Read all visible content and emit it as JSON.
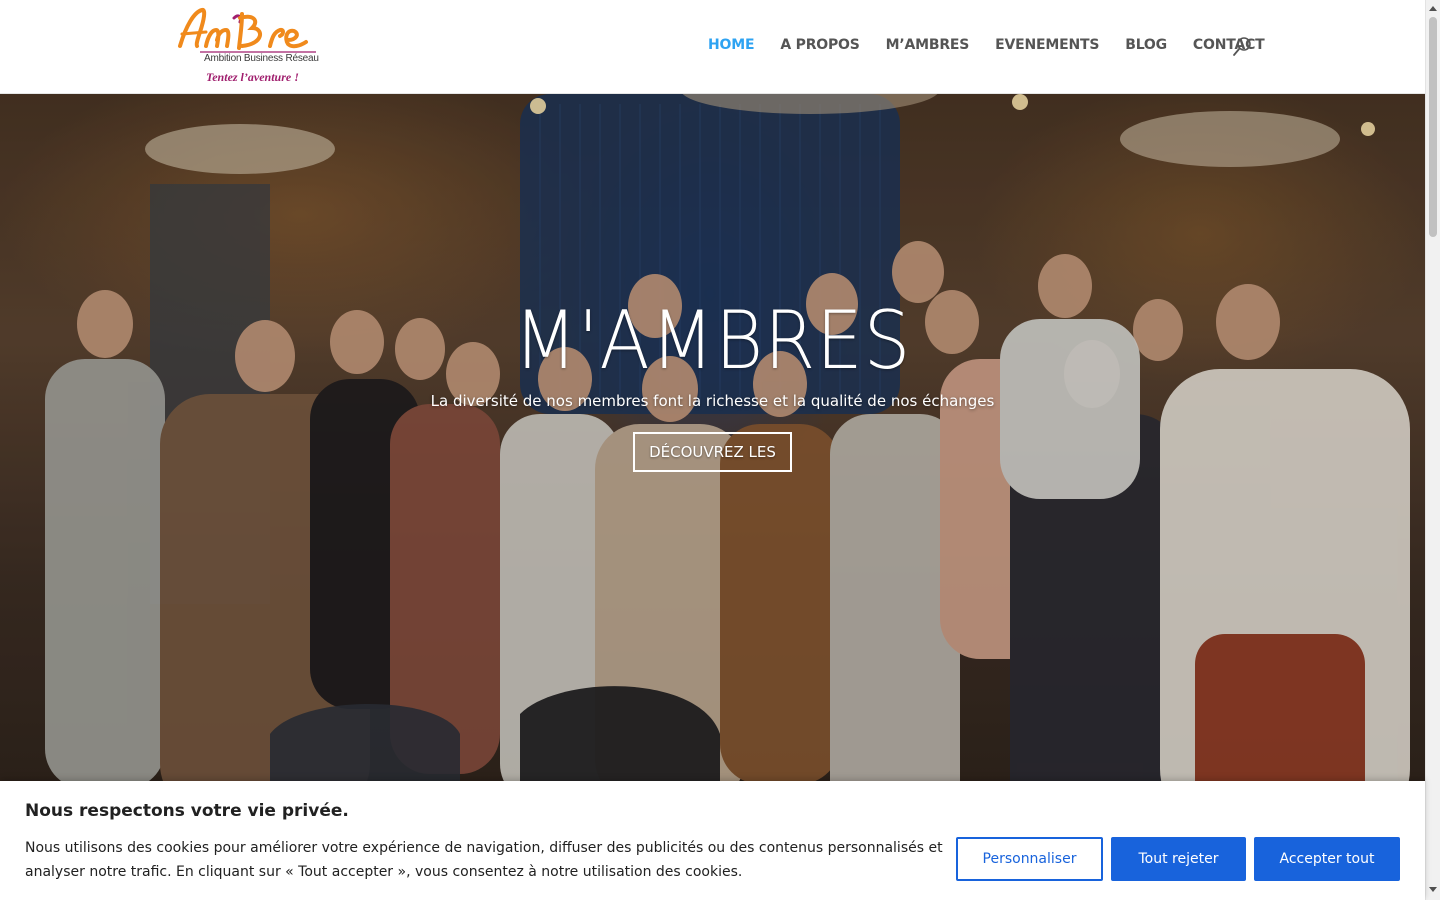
{
  "header": {
    "logo": {
      "brand": "AmBre",
      "tagline": "Ambition Business Réseau",
      "slogan": "Tentez l’aventure !"
    },
    "nav": [
      {
        "label": "HOME",
        "active": true
      },
      {
        "label": "A PROPOS",
        "active": false
      },
      {
        "label": "M’AMBRES",
        "active": false
      },
      {
        "label": "EVENEMENTS",
        "active": false
      },
      {
        "label": "BLOG",
        "active": false
      },
      {
        "label": "CONTACT",
        "active": false
      }
    ],
    "search_icon": "search-icon"
  },
  "hero": {
    "title": "M'AMBRES",
    "subtitle": "La diversité de nos membres font la richesse et la qualité de nos échanges",
    "button_label": "DÉCOUVREZ LES"
  },
  "cookie_banner": {
    "title": "Nous respectons votre vie privée.",
    "text": "Nous utilisons des cookies pour améliorer votre expérience de navigation, diffuser des publicités ou des contenus personnalisés et analyser notre trafic. En cliquant sur « Tout accepter », vous consentez à notre utilisation des cookies.",
    "buttons": {
      "customize": "Personnaliser",
      "reject": "Tout rejeter",
      "accept": "Accepter tout"
    }
  },
  "colors": {
    "nav_active": "#2ea3f2",
    "nav_default": "#555555",
    "cookie_primary": "#1863dc",
    "logo_orange": "#f08a1c",
    "logo_magenta": "#a01f6e"
  }
}
